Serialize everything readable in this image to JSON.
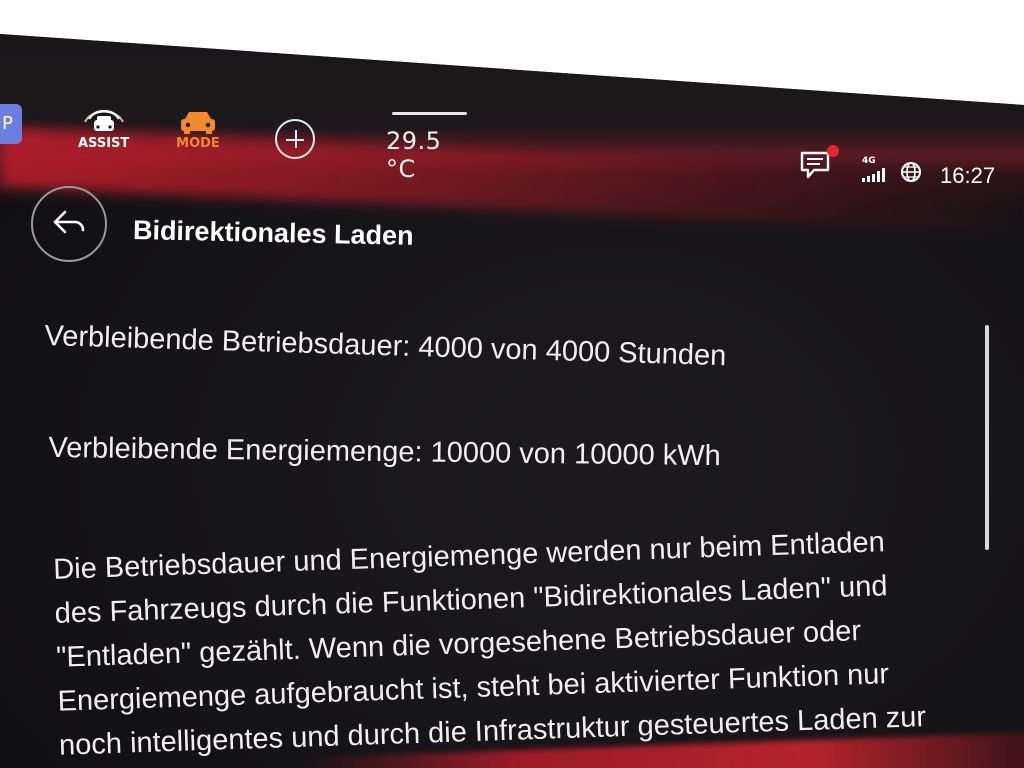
{
  "statusbar": {
    "left_tab_label": "P",
    "assist_label": "ASSIST",
    "mode_label": "MODE",
    "temperature": "29.5 °C",
    "network_label": "4G",
    "time": "16:27",
    "icons": {
      "assist": "car-assist-icon",
      "mode": "car-mode-icon",
      "add": "plus-icon",
      "messages": "message-icon",
      "signal": "signal-icon",
      "globe": "globe-icon"
    },
    "colors": {
      "mode_accent": "#f08a2c",
      "notification_dot": "#e8232f",
      "accent_red": "#be1e2d"
    }
  },
  "header": {
    "back_icon": "back-arrow-icon",
    "title": "Bidirektionales Laden"
  },
  "content": {
    "operating_time": "Verbleibende Betriebsdauer: 4000 von 4000 Stunden",
    "energy_amount": "Verbleibende Energiemenge: 10000 von 10000 kWh",
    "description": "Die Betriebsdauer und Energiemenge werden nur beim Entladen des Fahrzeugs durch die Funktionen \"Bidirektionales Laden\" und \"Entladen\" gezählt. Wenn die vorgesehene Betriebsdauer oder Energiemenge aufgebraucht ist, steht bei aktivierter Funktion nur noch intelligentes und durch die Infrastruktur gesteuertes Laden zur"
  }
}
